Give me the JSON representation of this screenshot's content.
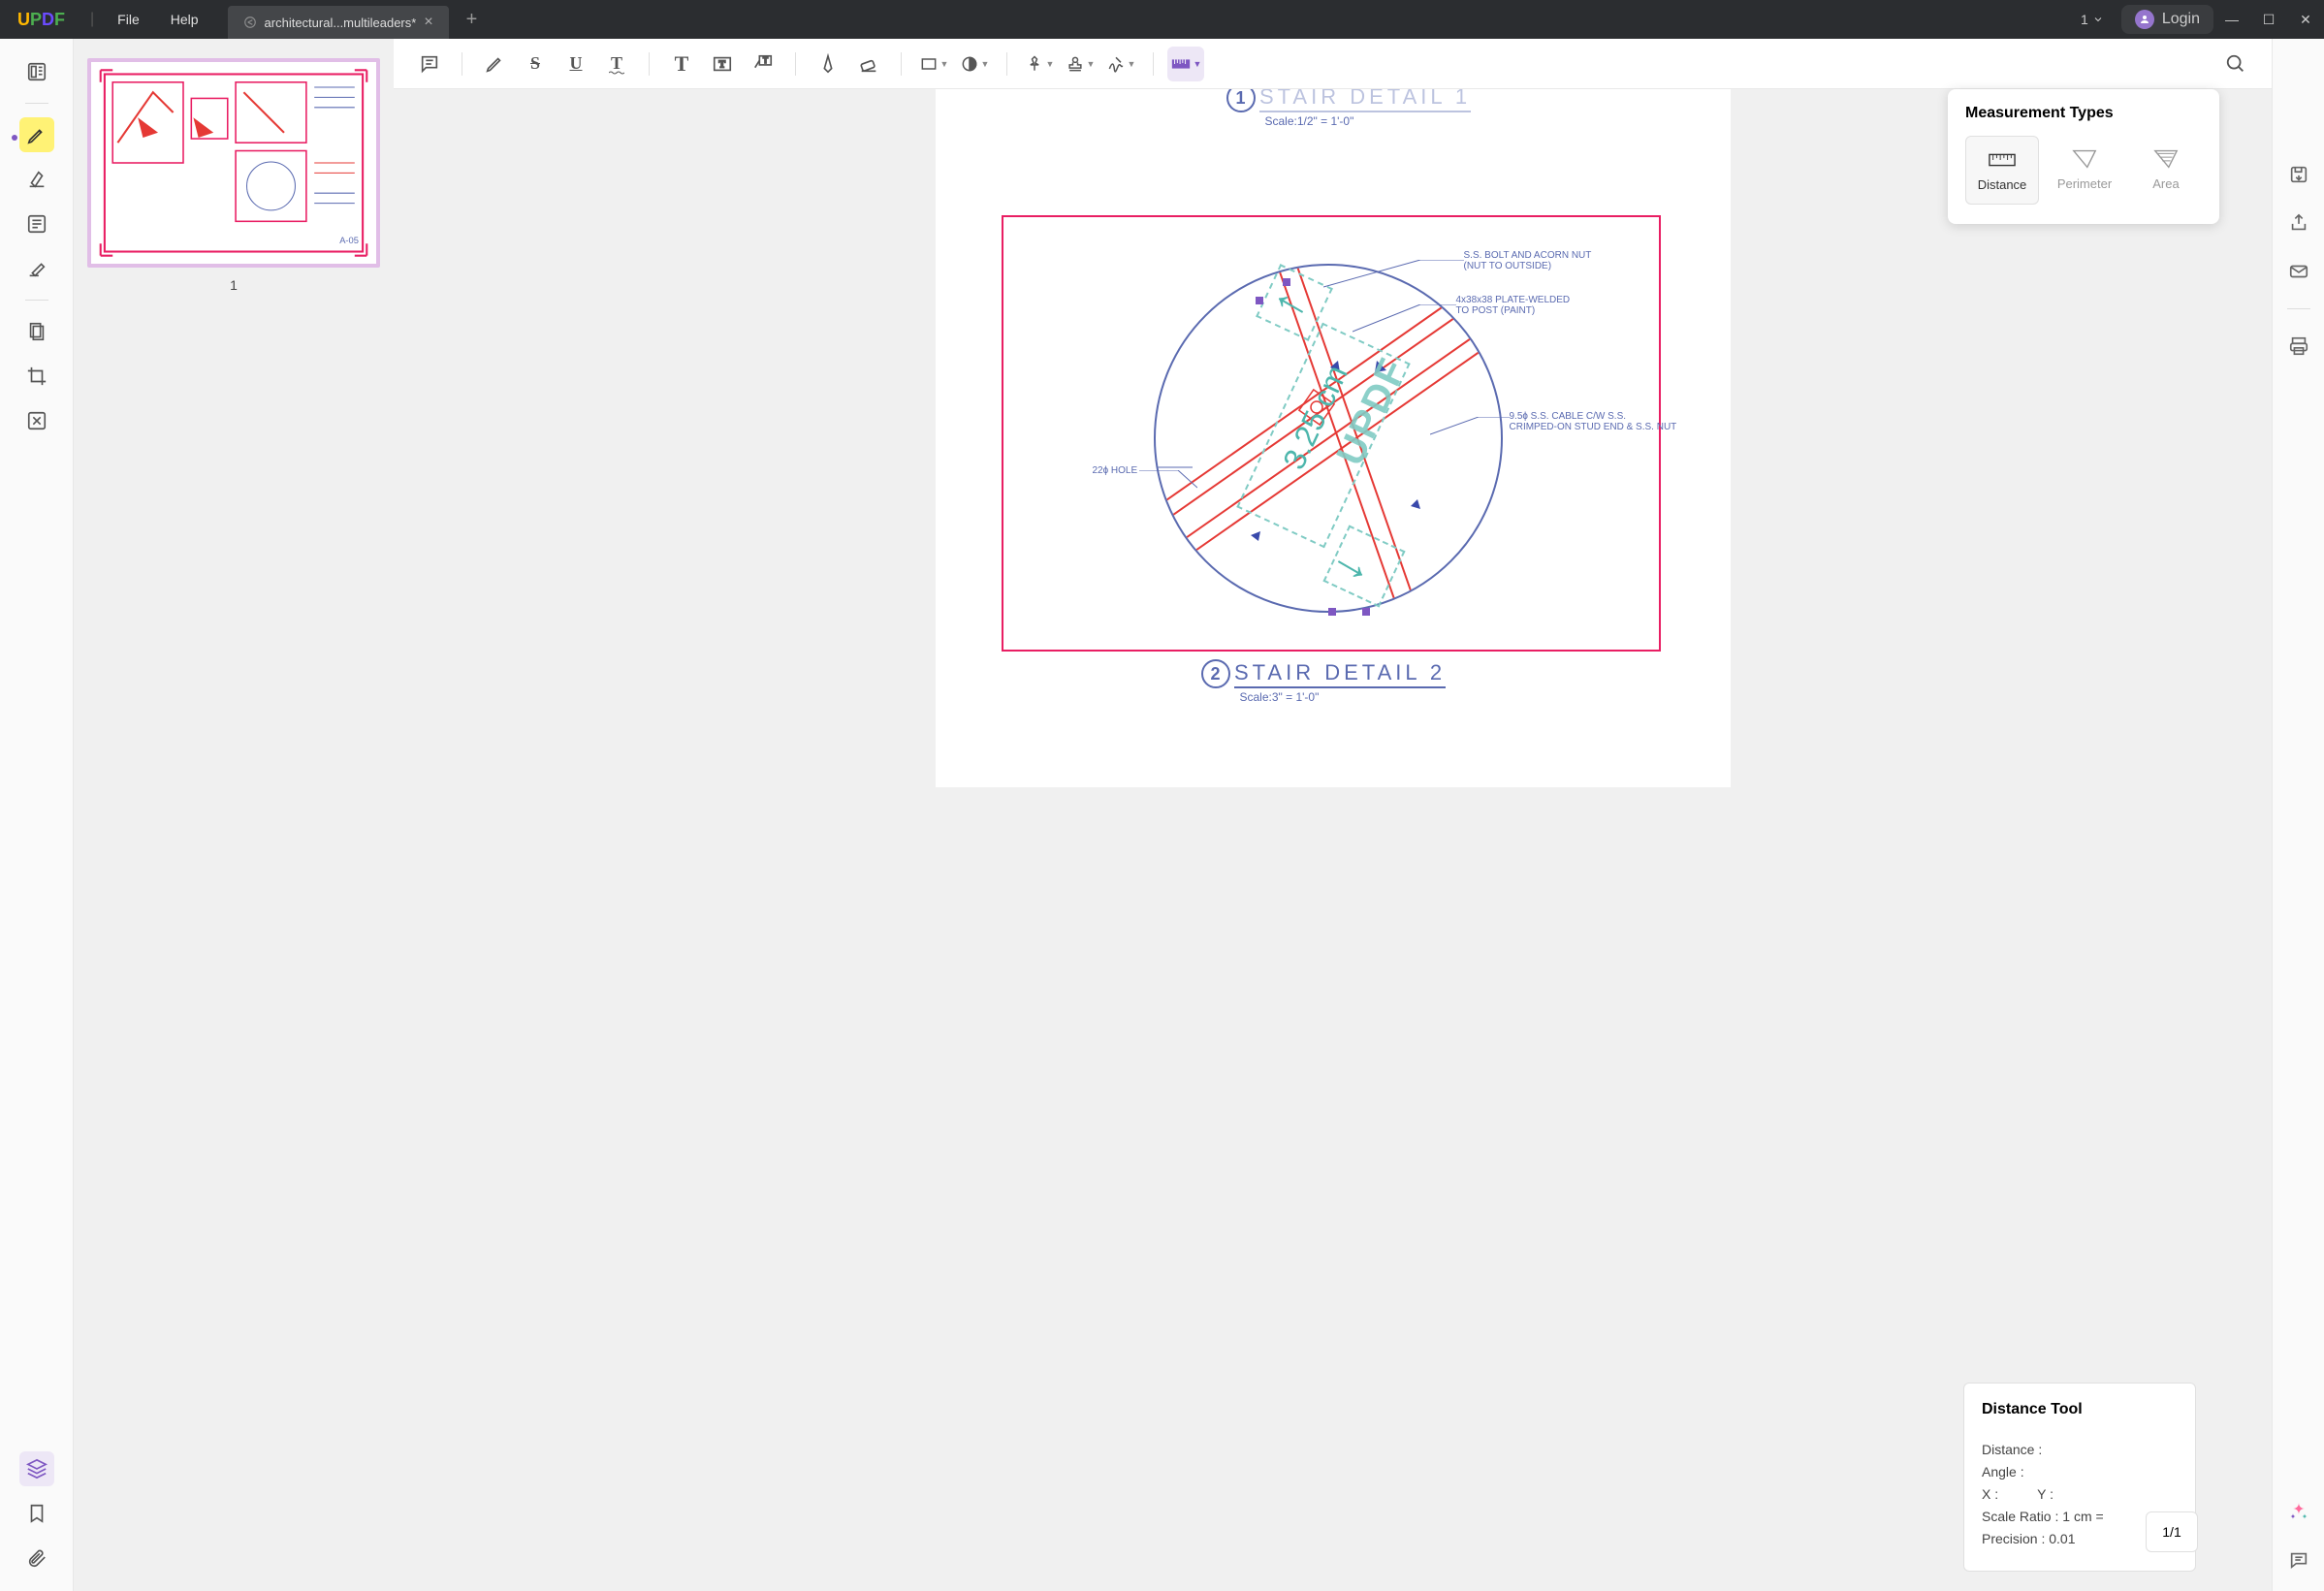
{
  "app": {
    "logo_U": "U",
    "logo_P": "P",
    "logo_D": "D",
    "logo_F": "F"
  },
  "menu": {
    "file": "File",
    "help": "Help"
  },
  "tab": {
    "name": "architectural...multileaders*"
  },
  "titlebar": {
    "tabs_count": "1",
    "login": "Login"
  },
  "sidepanel": {
    "thumb_label": "1"
  },
  "toolbar": {
    "strike": "S",
    "underline": "U",
    "squiggle": "T",
    "text": "T"
  },
  "drawing": {
    "title1_num": "1",
    "title1_name": "STAIR DETAIL 1",
    "title1_scale": "Scale:1/2\" = 1'-0\"",
    "title2_num": "2",
    "title2_name": "STAIR DETAIL 2",
    "title2_scale": "Scale:3\" = 1'-0\"",
    "watermark": "UPDF",
    "measurement": "3.25 cm",
    "leader_bolt": "S.S. BOLT AND ACORN NUT\n(NUT TO OUTSIDE)",
    "leader_plate": "4x38x38 PLATE-WELDED\nTO POST (PAINT)",
    "leader_cable": "9.5ɸ S.S. CABLE C/W S.S.\nCRIMPED-ON STUD END & S.S. NUT",
    "leader_hole": "22ɸ HOLE"
  },
  "measure_panel": {
    "title": "Measurement Types",
    "distance": "Distance",
    "perimeter": "Perimeter",
    "area": "Area"
  },
  "distance_tool": {
    "title": "Distance Tool",
    "distance": "Distance :",
    "angle": "Angle :",
    "x": "X :",
    "y": "Y :",
    "scale": "Scale Ratio : 1 cm =",
    "precision": "Precision : 0.01"
  },
  "page_indicator": "1/1"
}
